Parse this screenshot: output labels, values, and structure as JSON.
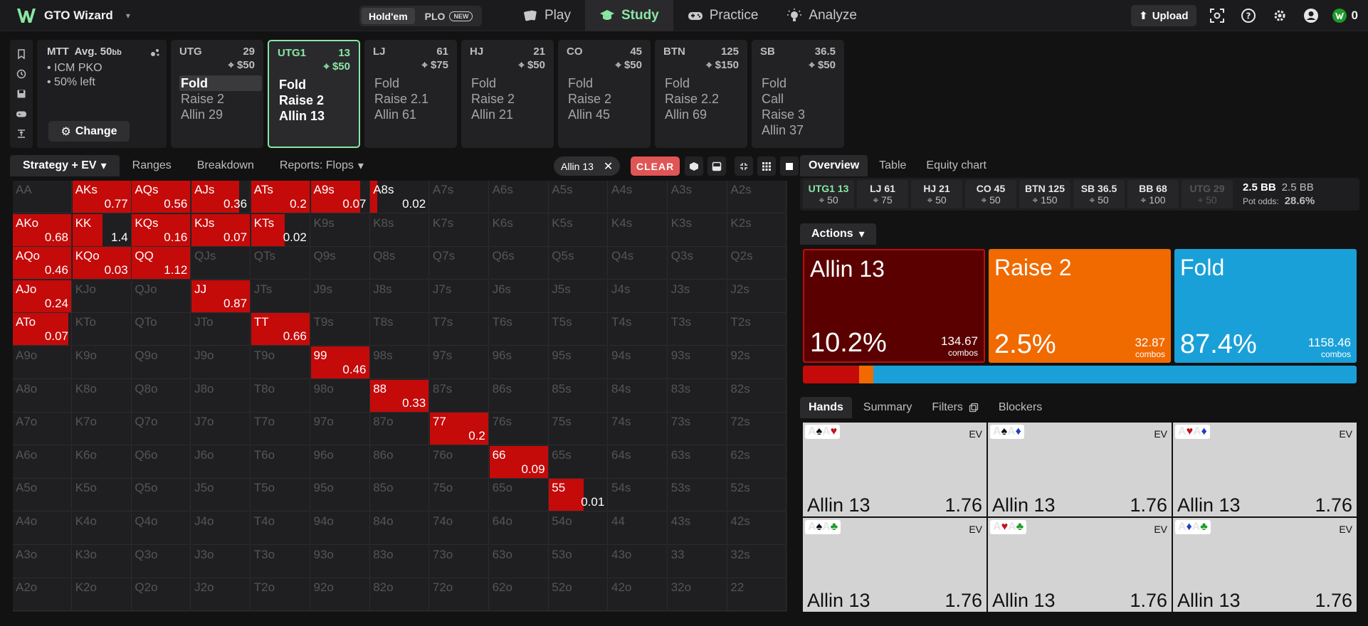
{
  "app": {
    "name": "GTO Wizard",
    "game_modes": [
      "Hold'em",
      "PLO"
    ],
    "new_badge": "NEW",
    "nav": [
      "Play",
      "Study",
      "Practice",
      "Analyze"
    ],
    "upload": "Upload",
    "coins": "0",
    "accent": "#8ae6a3"
  },
  "spot": {
    "title": "MTT",
    "avg_label": "Avg. 50",
    "avg_unit": "bb",
    "bullets": [
      "ICM PKO",
      "50% left"
    ],
    "change": "Change"
  },
  "positions": [
    {
      "name": "UTG",
      "stack": "29",
      "bounty": "$50",
      "actions": [
        "Fold",
        "Raise 2",
        "Allin 29"
      ],
      "selected": 0,
      "active": false
    },
    {
      "name": "UTG1",
      "stack": "13",
      "bounty": "$50",
      "actions": [
        "Fold",
        "Raise 2",
        "Allin 13"
      ],
      "selected": -1,
      "active": true
    },
    {
      "name": "LJ",
      "stack": "61",
      "bounty": "$75",
      "actions": [
        "Fold",
        "Raise 2.1",
        "Allin 61"
      ],
      "selected": -1,
      "active": false
    },
    {
      "name": "HJ",
      "stack": "21",
      "bounty": "$50",
      "actions": [
        "Fold",
        "Raise 2",
        "Allin 21"
      ],
      "selected": -1,
      "active": false
    },
    {
      "name": "CO",
      "stack": "45",
      "bounty": "$50",
      "actions": [
        "Fold",
        "Raise 2",
        "Allin 45"
      ],
      "selected": -1,
      "active": false
    },
    {
      "name": "BTN",
      "stack": "125",
      "bounty": "$150",
      "actions": [
        "Fold",
        "Raise 2.2",
        "Allin 69"
      ],
      "selected": -1,
      "active": false
    },
    {
      "name": "SB",
      "stack": "36.5",
      "bounty": "$50",
      "actions": [
        "Fold",
        "Call",
        "Raise 3",
        "Allin 37"
      ],
      "selected": -1,
      "active": false
    }
  ],
  "strategy_tabs": [
    "Strategy + EV",
    "Ranges",
    "Breakdown",
    "Reports: Flops"
  ],
  "filter_chip": "Allin 13",
  "clear": "CLEAR",
  "ranks": [
    "A",
    "K",
    "Q",
    "J",
    "T",
    "9",
    "8",
    "7",
    "6",
    "5",
    "4",
    "3",
    "2"
  ],
  "grid_values": {
    "AA": {
      "f": 0,
      "ev": ""
    },
    "AKs": {
      "f": 1,
      "ev": "0.77"
    },
    "AQs": {
      "f": 1,
      "ev": "0.56"
    },
    "AJs": {
      "f": 0.82,
      "ev": "0.36"
    },
    "ATs": {
      "f": 1,
      "ev": "0.2"
    },
    "A9s": {
      "f": 0.85,
      "ev": "0.07"
    },
    "A8s": {
      "f": 0.12,
      "ev": "0.02"
    },
    "AKo": {
      "f": 1,
      "ev": "0.68"
    },
    "KK": {
      "f": 0.52,
      "ev": "1.4"
    },
    "KQs": {
      "f": 1,
      "ev": "0.16"
    },
    "KJs": {
      "f": 1,
      "ev": "0.07"
    },
    "KTs": {
      "f": 0.57,
      "ev": "0.02"
    },
    "AQo": {
      "f": 1,
      "ev": "0.46"
    },
    "KQo": {
      "f": 1,
      "ev": "0.03"
    },
    "QQ": {
      "f": 1,
      "ev": "1.12"
    },
    "AJo": {
      "f": 1,
      "ev": "0.24"
    },
    "JJ": {
      "f": 1,
      "ev": "0.87"
    },
    "ATo": {
      "f": 0.95,
      "ev": "0.07"
    },
    "TT": {
      "f": 1,
      "ev": "0.66"
    },
    "99": {
      "f": 1,
      "ev": "0.46"
    },
    "88": {
      "f": 1,
      "ev": "0.33"
    },
    "77": {
      "f": 1,
      "ev": "0.2"
    },
    "66": {
      "f": 1,
      "ev": "0.09"
    },
    "55": {
      "f": 0.6,
      "ev": "0.01"
    }
  },
  "right_tabs": [
    "Overview",
    "Table",
    "Equity chart"
  ],
  "pos_strip": [
    {
      "name": "UTG1 13",
      "bounty": "50",
      "state": "active"
    },
    {
      "name": "LJ 61",
      "bounty": "75",
      "state": ""
    },
    {
      "name": "HJ 21",
      "bounty": "50",
      "state": ""
    },
    {
      "name": "CO 45",
      "bounty": "50",
      "state": ""
    },
    {
      "name": "BTN 125",
      "bounty": "150",
      "state": ""
    },
    {
      "name": "SB 36.5",
      "bounty": "50",
      "state": ""
    },
    {
      "name": "BB 68",
      "bounty": "100",
      "state": ""
    },
    {
      "name": "UTG 29",
      "bounty": "50",
      "state": "dim"
    }
  ],
  "pot": {
    "main": "2.5 BB",
    "sub": "2.5 BB",
    "odds_label": "Pot odds:",
    "odds": "28.6%"
  },
  "actions_label": "Actions",
  "action_summary": [
    {
      "name": "Allin 13",
      "pct": "10.2%",
      "combos": "134.67",
      "combos_label": "combos",
      "color": "#5a0000",
      "freq": 10.2
    },
    {
      "name": "Raise 2",
      "pct": "2.5%",
      "combos": "32.87",
      "combos_label": "combos",
      "color": "#f06a00",
      "freq": 2.5
    },
    {
      "name": "Fold",
      "pct": "87.4%",
      "combos": "1158.46",
      "combos_label": "combos",
      "color": "#1aa0d8",
      "freq": 87.4
    }
  ],
  "bar_colors": {
    "allin": "#c50a0a",
    "raise": "#f06a00",
    "fold": "#1aa0d8"
  },
  "hand_tabs": [
    "Hands",
    "Summary",
    "Filters",
    "Blockers"
  ],
  "hands": [
    {
      "c1": "A",
      "s1": "♠",
      "k1": "s",
      "c2": "A",
      "s2": "♥",
      "k2": "h",
      "ev_label": "EV",
      "action": "Allin 13",
      "value": "1.76"
    },
    {
      "c1": "A",
      "s1": "♠",
      "k1": "s",
      "c2": "A",
      "s2": "♦",
      "k2": "d",
      "ev_label": "EV",
      "action": "Allin 13",
      "value": "1.76"
    },
    {
      "c1": "A",
      "s1": "♥",
      "k1": "h",
      "c2": "A",
      "s2": "♦",
      "k2": "d",
      "ev_label": "EV",
      "action": "Allin 13",
      "value": "1.76"
    },
    {
      "c1": "A",
      "s1": "♠",
      "k1": "s",
      "c2": "A",
      "s2": "♣",
      "k2": "c",
      "ev_label": "EV",
      "action": "Allin 13",
      "value": "1.76"
    },
    {
      "c1": "A",
      "s1": "♥",
      "k1": "h",
      "c2": "A",
      "s2": "♣",
      "k2": "c",
      "ev_label": "EV",
      "action": "Allin 13",
      "value": "1.76"
    },
    {
      "c1": "A",
      "s1": "♦",
      "k1": "d",
      "c2": "A",
      "s2": "♣",
      "k2": "c",
      "ev_label": "EV",
      "action": "Allin 13",
      "value": "1.76"
    }
  ]
}
